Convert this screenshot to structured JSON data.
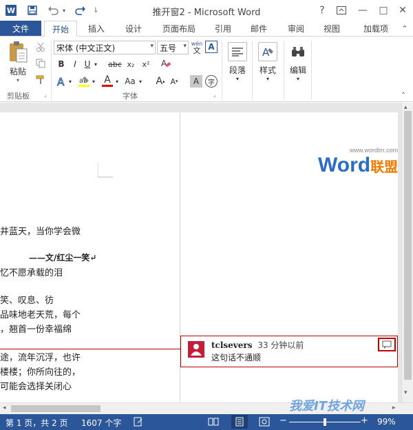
{
  "titlebar": {
    "title": "推开窗2 - Microsoft Word",
    "help": "?",
    "minimize": "—",
    "restore": "□",
    "close": "✕"
  },
  "tabs": {
    "file": "文件",
    "items": [
      "开始",
      "插入",
      "设计",
      "页面布局",
      "引用",
      "邮件",
      "审阅",
      "视图",
      "加载项"
    ],
    "active_index": 0
  },
  "ribbon": {
    "clipboard": {
      "paste": "粘贴",
      "group": "剪贴板"
    },
    "font": {
      "font_name": "宋体 (中文正文)",
      "font_size": "五号",
      "wen_top": "wén",
      "wen_bottom": "文",
      "bold": "B",
      "italic": "I",
      "underline": "U",
      "strike": "abc",
      "subscript": "x₂",
      "superscript": "x²",
      "font_color_glyph": "A",
      "change_case": "Aa",
      "grow": "A",
      "shrink": "A",
      "shade": "A",
      "circle": "字",
      "group": "字体"
    },
    "paragraph": {
      "label": "段落"
    },
    "styles": {
      "label": "样式"
    },
    "editing": {
      "label": "编辑"
    }
  },
  "document": {
    "lines": [
      "井蓝天，当你学会微",
      "——文/红尘一笑↵",
      "忆不愿承载的泪",
      "笑、叹息、彷",
      "品味地老天荒，每个",
      "，翘首一份幸福绵",
      "途，流年沉浮，也许",
      "楼楼；你所向往的，",
      "可能会选择关闭心"
    ]
  },
  "watermark": {
    "url": "www.wordlm.com",
    "brand_en": "Word",
    "brand_cn": "联盟",
    "bottom_cn": "我爱IT技术网"
  },
  "comment": {
    "author": "tclsevers",
    "time": "33 分钟以前",
    "text": "这句话不通顺"
  },
  "statusbar": {
    "page": "第 1 页，共 2 页",
    "words": "1607 个字",
    "zoom": "99%"
  },
  "colors": {
    "accent": "#2b579a",
    "comment_border": "#c00000",
    "avatar": "#c41e3a"
  }
}
